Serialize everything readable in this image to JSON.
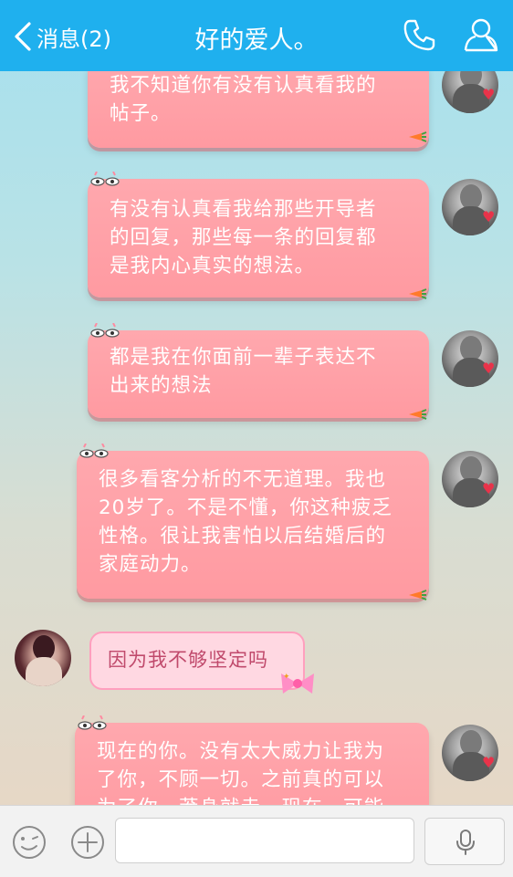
{
  "header": {
    "back_label": "消息(2)",
    "title": "好的爱人。",
    "bg_color": "#1fb0ee"
  },
  "messages": [
    {
      "sender": "self",
      "text": "我不知道你有没有认真看我的\n帖子。"
    },
    {
      "sender": "self",
      "text": "有没有认真看我给那些开导者\n的回复，那些每一条的回复都\n是我内心真实的想法。"
    },
    {
      "sender": "self",
      "text": "都是我在你面前一辈子表达不\n出来的想法"
    },
    {
      "sender": "self",
      "text": "很多看客分析的不无道理。我也\n20岁了。不是不懂，你这种疲乏\n性格。很让我害怕以后结婚后的\n家庭动力。"
    },
    {
      "sender": "other",
      "text": "因为我不够坚定吗"
    },
    {
      "sender": "self",
      "text": "现在的你。没有太大威力让我为\n了你，不顾一切。之前真的可以\n为了你，莽身就走。现在，可能"
    }
  ],
  "composer": {
    "input_value": "",
    "icons": [
      "emoji-icon",
      "plus-icon",
      "microphone-icon"
    ]
  },
  "colors": {
    "bubble_out": "#ff9aa1",
    "bubble_in": "#ffd8e2",
    "bubble_in_text": "#c04a6c"
  }
}
